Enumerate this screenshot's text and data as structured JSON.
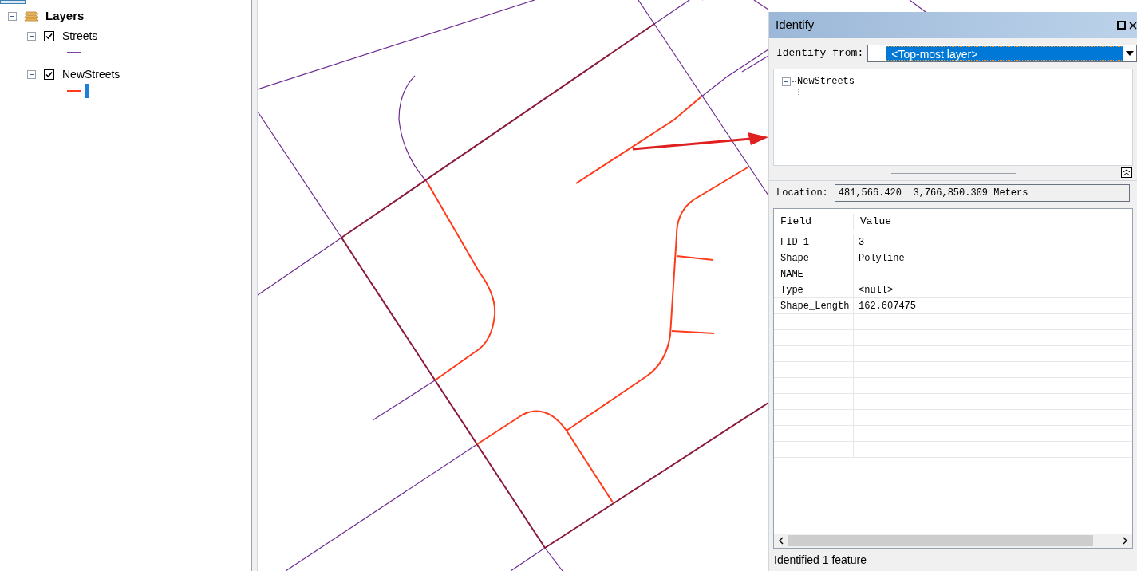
{
  "toc": {
    "title": "Layers",
    "expanded": true,
    "layers": [
      {
        "name": "Streets",
        "checked": true,
        "expanded": true,
        "color": "#7b3fa0"
      },
      {
        "name": "NewStreets",
        "checked": true,
        "expanded": true,
        "color": "#ff3b1a"
      }
    ]
  },
  "identify": {
    "title": "Identify",
    "from_label": "Identify from:",
    "from_value": "<Top-most layer>",
    "tree": [
      {
        "label": "NewStreets",
        "expanded": true
      }
    ],
    "location_label": "Location:",
    "location_value": "481,566.420  3,766,850.309 Meters",
    "columns": [
      "Field",
      "Value"
    ],
    "rows": [
      {
        "field": "FID_1",
        "value": "3"
      },
      {
        "field": "Shape",
        "value": "Polyline"
      },
      {
        "field": "NAME",
        "value": ""
      },
      {
        "field": "Type",
        "value": "<null>"
      },
      {
        "field": "Shape_Length",
        "value": "162.607475"
      }
    ],
    "status": "Identified 1 feature"
  }
}
